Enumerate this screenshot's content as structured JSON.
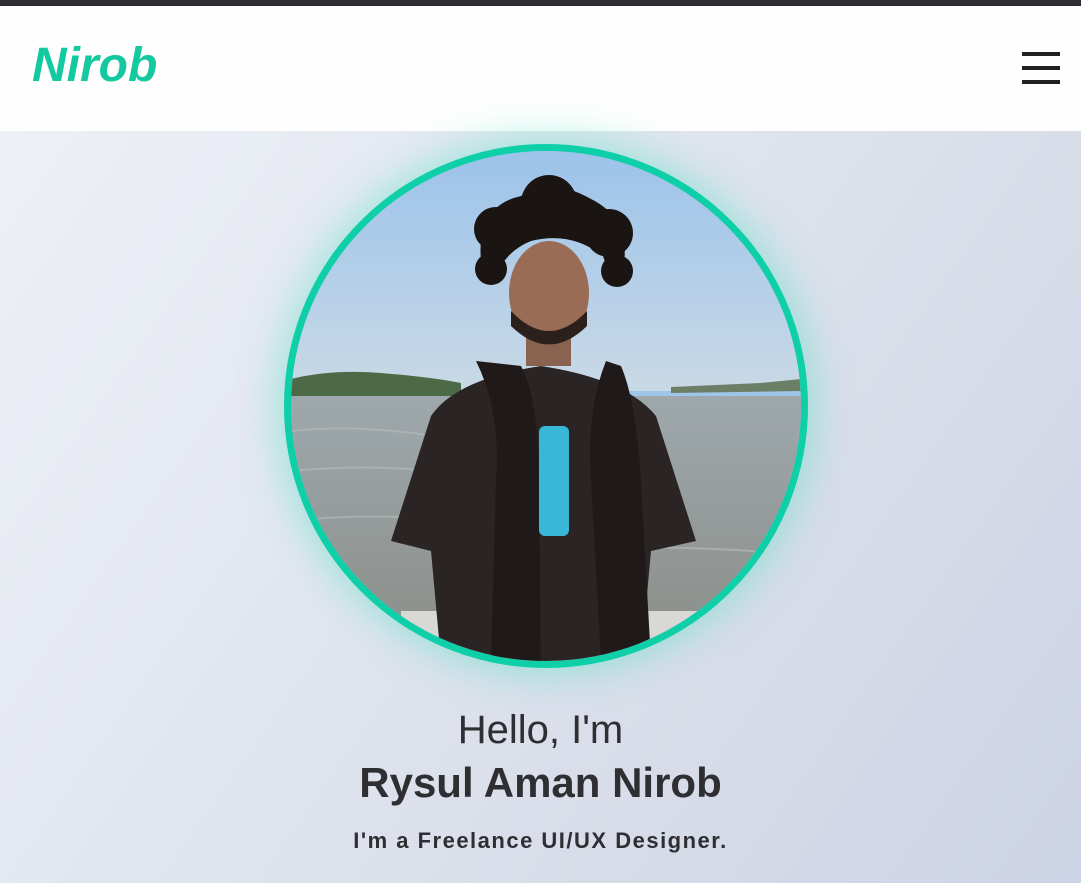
{
  "header": {
    "brand": "Nirob",
    "menu_icon": "hamburger-menu-icon"
  },
  "hero": {
    "greeting": "Hello, I'm",
    "name": "Rysul Aman Nirob",
    "tagline": "I'm a Freelance UI/UX Designer."
  },
  "colors": {
    "accent": "#14c8a0",
    "text": "#2f2f33",
    "topbar": "#2d2d33"
  }
}
